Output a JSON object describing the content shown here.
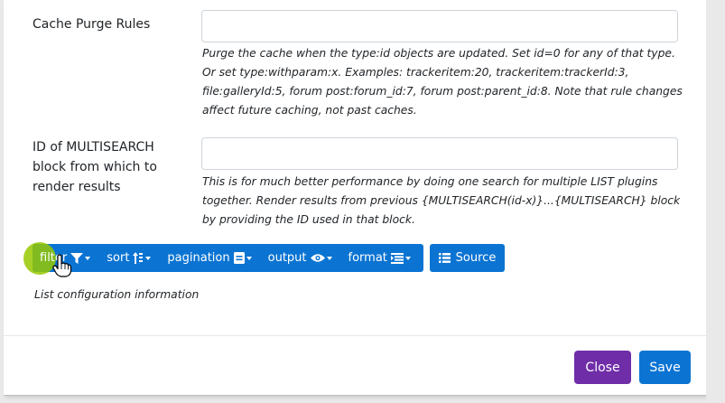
{
  "fields": [
    {
      "label": "Cache Purge Rules",
      "value": "",
      "help": "Purge the cache when the type:id objects are updated. Set id=0 for any of that type. Or set type:withparam:x. Examples: trackeritem:20, trackeritem:trackerId:3, file:galleryId:5, forum post:forum_id:7, forum post:parent_id:8. Note that rule changes affect future caching, not past caches."
    },
    {
      "label": "ID of MULTISEARCH block from which to render results",
      "value": "",
      "help": "This is for much better performance by doing one search for multiple LIST plugins together. Render results from previous {MULTISEARCH(id-x)}...{MULTISEARCH} block by providing the ID used in that block."
    }
  ],
  "toolbar": {
    "items": [
      {
        "label": "filter",
        "icon": "filter-icon"
      },
      {
        "label": "sort",
        "icon": "sort-icon"
      },
      {
        "label": "pagination",
        "icon": "pagination-icon"
      },
      {
        "label": "output",
        "icon": "eye-icon"
      },
      {
        "label": "format",
        "icon": "format-list-icon"
      }
    ],
    "source_label": "Source",
    "source_icon": "list-icon"
  },
  "config_info": "List configuration information",
  "footer": {
    "close_label": "Close",
    "save_label": "Save"
  },
  "colors": {
    "primary": "#0b74d3",
    "close": "#6f2da8",
    "highlight": "#96c800"
  }
}
